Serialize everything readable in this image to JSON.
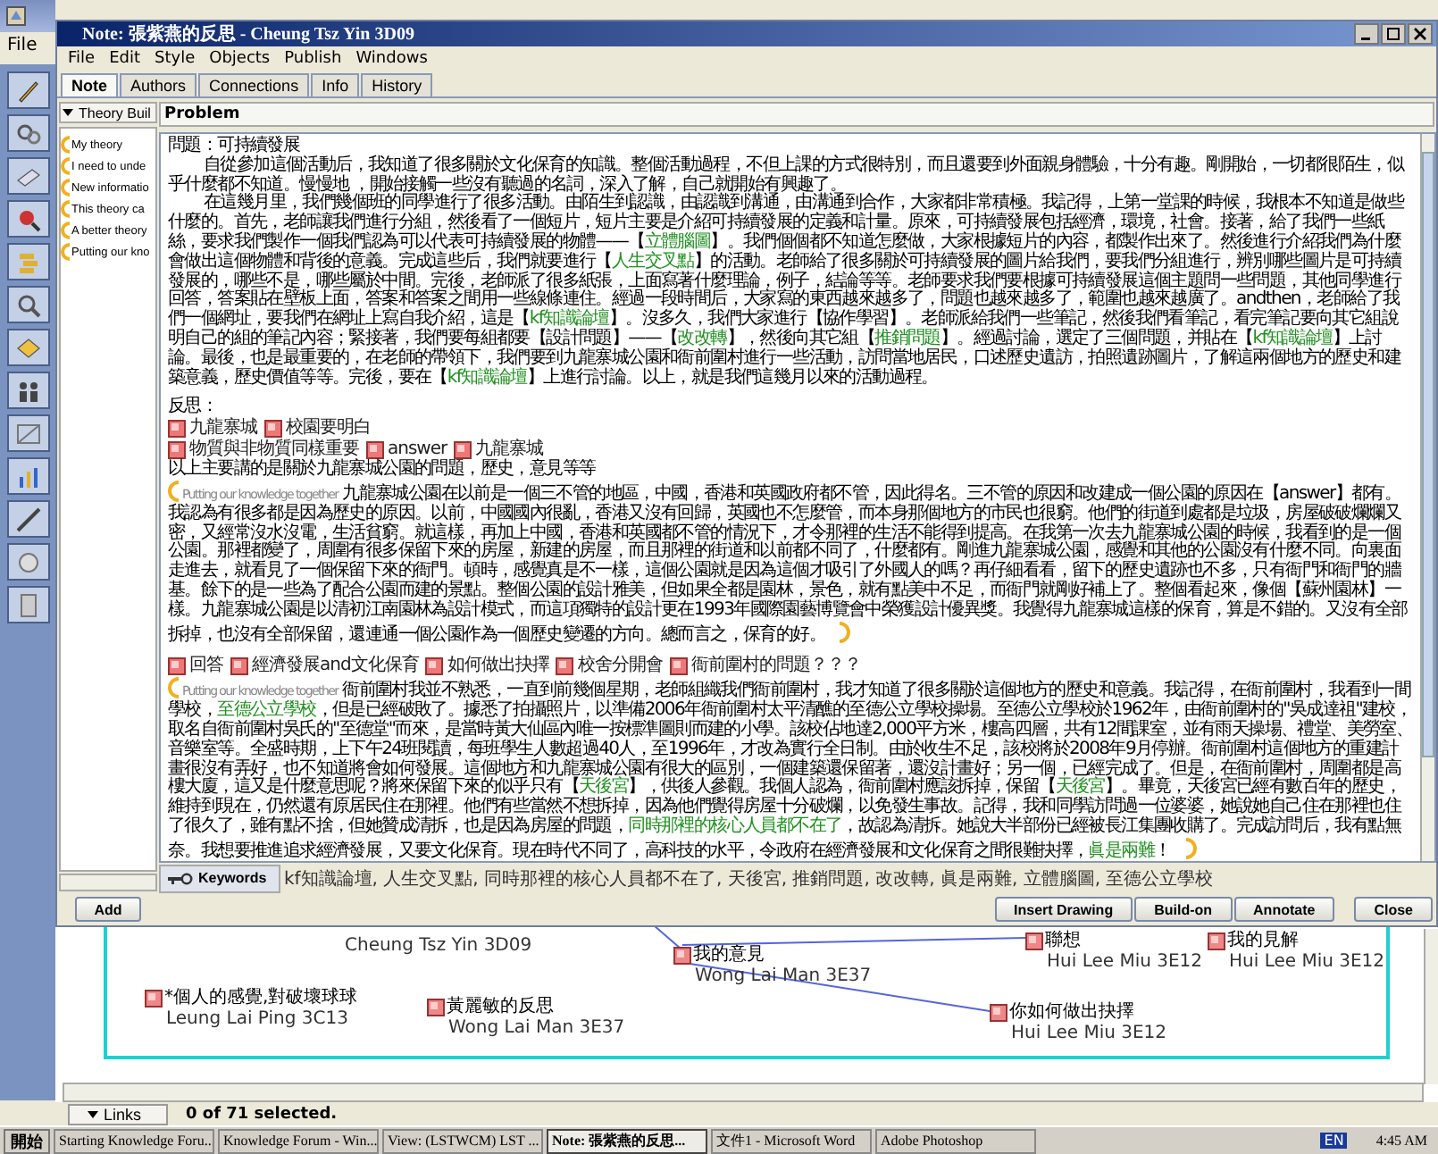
{
  "app": {
    "menu": [
      "File"
    ]
  },
  "note_window": {
    "title": "Note: 張紫燕的反思 - Cheung Tsz Yin 3D09",
    "menu": [
      "File",
      "Edit",
      "Style",
      "Objects",
      "Publish",
      "Windows"
    ],
    "tabs": [
      {
        "label": "Note",
        "selected": true
      },
      {
        "label": "Authors",
        "selected": false
      },
      {
        "label": "Connections",
        "selected": false
      },
      {
        "label": "Info",
        "selected": false
      },
      {
        "label": "History",
        "selected": false
      }
    ],
    "scaffold_panel": {
      "title": "Theory Buil",
      "items": [
        "My theory",
        "I need to unde",
        "New informatio",
        "This theory ca",
        "A better theory",
        "Putting our kno"
      ],
      "add_button": "Add"
    },
    "problem_field": {
      "value": "Problem"
    },
    "content": [
      {
        "kind": "line",
        "segments": [
          {
            "text": "問題：可持續發展",
            "link": false
          }
        ]
      },
      {
        "kind": "paragraph",
        "segments": [
          {
            "text": "自從參加這個活動后，我知道了很多關於文化保育的知識。整個活動過程，不但上課的方式很特別，而且還要到外面親身體驗，十分有趣。剛開始，一切都很陌生，似乎什麼都不知道。慢慢地 ，開始接觸一些沒有聽過的名詞，深入了解，自己就開始有興趣了。",
            "link": false
          }
        ]
      },
      {
        "kind": "paragraph",
        "segments": [
          {
            "text": "在這幾月里，我們幾個班的同學進行了很多活動。由陌生到認識，由認識到溝通，由溝通到合作，大家都非常積極。我記得，上第一堂課的時候，我根本不知道是做些什麼的。首先，老師讓我們進行分組，然後看了一個短片，短片主要是介紹可持續發展的定義和計量。原來，可持續發展包括經濟，環境，社會。接著，給了我們一些紙絲，要求我們製作一個我們認為可以代表可持續發展的物體——【",
            "link": false
          },
          {
            "text": "立體腦圖",
            "link": true
          },
          {
            "text": "】。我們個個都不知道怎麼做，大家根據短片的內容，都製作出來了。然後進行介紹我們為什麼會做出這個物體和背後的意義。完成這些后，我們就要進行【",
            "link": false
          },
          {
            "text": "人生交叉點",
            "link": true
          },
          {
            "text": "】的活動。老師給了很多關於可持續發展的圖片給我們，要我們分組進行，辨別哪些圖片是可持續發展的，哪些不是，哪些屬於中間。完後，老師派了很多紙張，上面寫著什麼理論，例子，結論等等。老師要求我們要根據可持續發展這個主題問一些問題，其他同學進行回答，答案貼在壁板上面，答案和答案之間用一些線條連住。經過一段時間后，大家寫的東西越來越多了，問題也越來越多了，範圍也越來越廣了。andthen，老師給了我們一個網址，要我們在網址上寫自我介紹，這是【",
            "link": false
          },
          {
            "text": "kf知識論壇",
            "link": true
          },
          {
            "text": "】。沒多久，我們大家進行【協作學習】。老師派給我們一些筆記，然後我們看筆記，看完筆記要向其它組說明自己的組的筆記內容；緊接著，我們要每組都要【設計問題】——【",
            "link": false
          },
          {
            "text": "改改轉",
            "link": true
          },
          {
            "text": "】，然後向其它組【",
            "link": false
          },
          {
            "text": "推銷問題",
            "link": true
          },
          {
            "text": "】。經過討論，選定了三個問題，并貼在【",
            "link": false
          },
          {
            "text": "kf知識論壇",
            "link": true
          },
          {
            "text": "】上討論。最後，也是最重要的，在老師的帶領下，我們要到九龍寨城公園和衙前圍村進行一些活動，訪問當地居民，口述歷史遺訪，拍照遺跡圖片，了解這兩個地方的歷史和建築意義，歷史價值等等。完後，要在【",
            "link": false
          },
          {
            "text": "kf知識論壇",
            "link": true
          },
          {
            "text": "】上進行討論。以上，就是我們這幾月以來的活動過程。",
            "link": false
          }
        ]
      },
      {
        "kind": "gap"
      },
      {
        "kind": "line",
        "segments": [
          {
            "text": "反思：",
            "link": false
          }
        ]
      },
      {
        "kind": "tags",
        "tags": [
          "九龍寨城",
          "校園要明白"
        ]
      },
      {
        "kind": "tags",
        "tags": [
          "物質與非物質同樣重要",
          "answer",
          "九龍寨城"
        ]
      },
      {
        "kind": "line",
        "segments": [
          {
            "text": "以上主要講的是關於九龍寨城公園的問題，歷史，意見等等",
            "link": false
          }
        ]
      },
      {
        "kind": "scaffold",
        "label": "Putting our knowledge together",
        "segments": [
          {
            "text": "九龍寨城公園在以前是一個三不管的地區，中國，香港和英國政府都不管，因此得名。三不管的原因和改建成一個公園的原因在【answer】都有。我認為有很多都是因為歷史的原因。以前，中國國內很亂，香港又沒有回歸，英國也不怎麼管，而本身那個地方的市民也很窮。他們的街道到處都是垃圾，房屋破破爛爛又密，又經常沒水沒電，生活貧窮。就這樣，再加上中國，香港和英國都不管的情況下，才令那裡的生活不能得到提高。在我第一次去九龍寨城公園的時候，我看到的是一個公園。那裡都變了，周圍有很多保留下來的房屋，新建的房屋，而且那裡的街道和以前都不同了，什麼都有。剛進九龍寨城公園，感覺和其他的公園沒有什麼不同。向裏面走進去，就看見了一個保留下來的衙門。頓時，感覺真是不一樣，這個公園就是因為這個才吸引了外國人的嗎？再仔細看看，留下的歷史遺跡也不多，只有衙門和衙門的牆基。餘下的是一些為了配合公園而建的景點。整個公園的設計雅美，但如果全都是園林，景色，就有點美中不足，而衙門就剛好補上了。整個看起來，像個【蘇州園林】一樣。九龍寨城公園是以清初江南園林為設計模式，而這項獨特的設計更在1993年國際園藝博覽會中榮獲設計優異獎。我覺得九龍寨城這樣的保育，算是不錯的。又沒有全部拆掉，也沒有全部保留，還連通一個公園作為一個歷史變遷的方向。總而言之，保育的好。",
            "link": false
          }
        ]
      },
      {
        "kind": "gap"
      },
      {
        "kind": "tags",
        "tags": [
          "回答",
          "經濟發展and文化保育",
          "如何做出抉擇",
          "校舍分開會",
          "衙前圍村的問題？？？"
        ]
      },
      {
        "kind": "scaffold",
        "label": "Putting our knowledge together",
        "segments": [
          {
            "text": "衙前圍村我並不熟悉，一直到前幾個星期，老師組織我們衙前圍村，我才知道了很多關於這個地方的歷史和意義。我記得，在衙前圍村，我看到一間學校，",
            "link": false
          },
          {
            "text": "至德公立學校",
            "link": true
          },
          {
            "text": "，但是已經破敗了。據悉了拍攝照片，以準備2006年衙前圍村太平清醮的至德公立學校操場。至德公立學校於1962年，由衙前圍村的\"吳成達祖\"建校，取名自衙前圍村吳氏的\"至德堂\"而來，是當時黃大仙區內唯一按標準圖則而建的小學。該校佔地達2,000平方米，樓高四層，共有12間課室，並有雨天操場、禮堂、美勞室、音樂室等。全盛時期，上下午24班閱讀，每班學生人數超過40人，至1996年，才改為實行全日制。由於收生不足，該校將於2008年9月停辦。衙前圍村這個地方的重建計畫很沒有弄好，也不知道將會如何發展。這個地方和九龍寨城公園有很大的區別，一個建築還保留著，還沒計畫好；另一個，已經完成了。但是，在衙前圍村，周圍都是高樓大廈，這又是什麼意思呢？將來保留下來的似乎只有【",
            "link": false
          },
          {
            "text": "天後宮",
            "link": true
          },
          {
            "text": "】，供後人參觀。我個人認為，衙前圍村應該拆掉，保留【",
            "link": false
          },
          {
            "text": "天後宮",
            "link": true
          },
          {
            "text": "】。畢竟，天後宮已經有數百年的歷史，維持到現在，仍然還有原居民住在那裡。他們有些當然不想拆掉，因為他們覺得房屋十分破爛，以免發生事故。記得，我和同學訪問過一位婆婆，她說她自己住在那裡也住了很久了，雖有點不捨，但她贊成清拆，也是因為房屋的問題，",
            "link": false
          },
          {
            "text": "同時那裡的核心人員都不在了",
            "link": true
          },
          {
            "text": "，故認為清拆。她說大半部份已經被長江集團收購了。完成訪問后，我有點無奈。我想要推進追求經濟發展，又要文化保育。現在時代不同了，高科技的水平，令政府在經濟發展和文化保育之間很難抉擇，",
            "link": false
          },
          {
            "text": "眞是兩難",
            "link": true
          },
          {
            "text": "！",
            "link": false
          }
        ]
      }
    ],
    "keywords_button": "Keywords",
    "keywords": "kf知識論壇, 人生交叉點, 同時那裡的核心人員都不在了, 天後宮, 推銷問題, 改改轉, 眞是兩難, 立體腦圖, 至德公立學校",
    "buttons": [
      "Insert Drawing",
      "Build-on",
      "Annotate",
      "Close"
    ]
  },
  "canvas": {
    "notes": [
      {
        "author": "Cheung Tsz Yin 3D09"
      },
      {
        "title": "我的意見",
        "author": "Wong Lai Man 3E37"
      },
      {
        "title": "聯想",
        "author": "Hui Lee Miu 3E12"
      },
      {
        "title": "我的見解",
        "author": "Hui Lee Miu 3E12"
      },
      {
        "title": "*個人的感覺,對破壞球球",
        "author": "Leung Lai Ping 3C13"
      },
      {
        "title": "黃麗敏的反思",
        "author": "Wong Lai Man 3E37"
      },
      {
        "title": "你如何做出抉擇",
        "author": "Hui Lee Miu 3E12"
      }
    ]
  },
  "status_bar": {
    "links_dropdown": "Links",
    "selection": "0 of 71 selected."
  },
  "taskbar": {
    "start": "開始",
    "items": [
      {
        "label": "Starting Knowledge Foru...",
        "selected": false
      },
      {
        "label": "Knowledge Forum - Win...",
        "selected": false
      },
      {
        "label": "View: (LSTWCM) LST ...",
        "selected": false
      },
      {
        "label": "Note: 張紫燕的反思...",
        "selected": true
      },
      {
        "label": "文件1 - Microsoft Word",
        "selected": false
      },
      {
        "label": "Adobe Photoshop",
        "selected": false
      }
    ],
    "language": "EN",
    "clock": "4:45 AM"
  }
}
